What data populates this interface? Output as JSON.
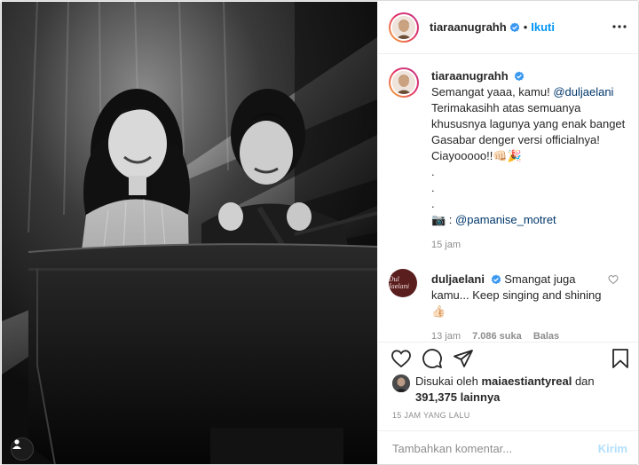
{
  "post": {
    "username": "tiaraanugrahh",
    "follow_label": "Ikuti",
    "separator": "•"
  },
  "caption": {
    "username": "tiaraanugrahh",
    "line1_text": "Semangat yaaa, kamu! ",
    "line1_mention": "@duljaelani",
    "lines": [
      "Terimakasihh atas semuanya",
      "khususnya lagunya yang enak banget",
      "Gasabar denger versi officialnya!"
    ],
    "last_line": "Ciayooooo!!",
    "last_line_emoji": "👊🏻🎉",
    "dots": [
      ".",
      ".",
      "."
    ],
    "credit_prefix": "📷 : ",
    "credit_mention": "@pamanise_motret",
    "time": "15 jam"
  },
  "reply": {
    "username": "duljaelani",
    "avatar_text": "Dul Jaelani",
    "text": "Smangat juga kamu... Keep singing and shining ",
    "emoji": "👍🏻",
    "time": "13 jam",
    "likes": "7.086 suka",
    "reply_label": "Balas"
  },
  "likes": {
    "prefix": "Disukai oleh ",
    "user": "maiaestiantyreal",
    "joiner": " dan",
    "others": "391,375 lainnya"
  },
  "timestamp": "15 JAM YANG LALU",
  "comment_box": {
    "placeholder": "Tambahkan komentar...",
    "send_label": "Kirim"
  },
  "colors": {
    "link": "#0095f6",
    "mention": "#00376b",
    "muted": "#8e8e8e",
    "verified": "#3897f0"
  },
  "icons": [
    "verified-badge-icon",
    "more-options-icon",
    "heart-icon",
    "comment-icon",
    "share-icon",
    "bookmark-icon"
  ]
}
